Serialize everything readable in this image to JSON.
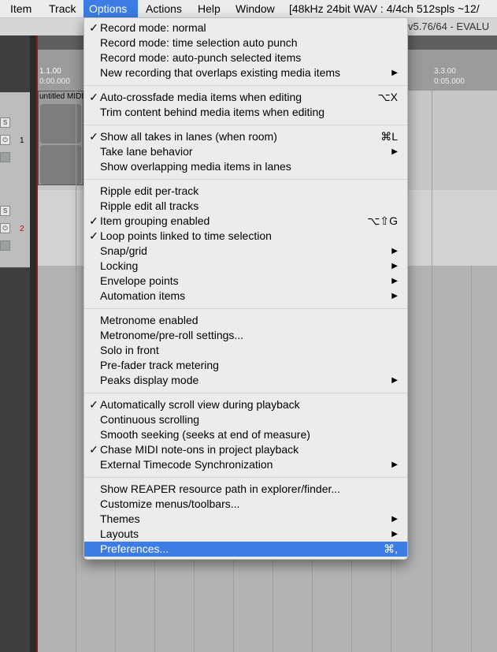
{
  "menubar": {
    "items": [
      "Item",
      "Track",
      "Options",
      "Actions",
      "Help",
      "Window"
    ],
    "active": "Options",
    "status": "[48kHz 24bit WAV : 4/4ch 512spls ~12/"
  },
  "window": {
    "version_text": "v5.76/64 - EVALU"
  },
  "ruler": {
    "marker_left": "1.1.00",
    "time_left": "0:00.000",
    "marker_right": "3.3.00",
    "time_right": "0:05.000"
  },
  "tracks": [
    {
      "number": "1",
      "button": "S"
    },
    {
      "number": "2",
      "button": "S"
    }
  ],
  "media_item": {
    "label": "untitled MIDI"
  },
  "menu": {
    "items": [
      {
        "label": "Record mode: normal",
        "checked": true
      },
      {
        "label": "Record mode: time selection auto punch"
      },
      {
        "label": "Record mode: auto-punch selected items"
      },
      {
        "label": "New recording that overlaps existing media items",
        "submenu": true
      },
      {
        "label": "Auto-crossfade media items when editing",
        "checked": true,
        "shortcut": "⌥X"
      },
      {
        "label": "Trim content behind media items when editing"
      },
      {
        "label": "Show all takes in lanes (when room)",
        "checked": true,
        "shortcut": "⌘L"
      },
      {
        "label": "Take lane behavior",
        "submenu": true
      },
      {
        "label": "Show overlapping media items in lanes"
      },
      {
        "label": "Ripple edit per-track"
      },
      {
        "label": "Ripple edit all tracks"
      },
      {
        "label": "Item grouping enabled",
        "checked": true,
        "shortcut": "⌥⇧G"
      },
      {
        "label": "Loop points linked to time selection",
        "checked": true
      },
      {
        "label": "Snap/grid",
        "submenu": true
      },
      {
        "label": "Locking",
        "submenu": true
      },
      {
        "label": "Envelope points",
        "submenu": true
      },
      {
        "label": "Automation items",
        "submenu": true
      },
      {
        "label": "Metronome enabled"
      },
      {
        "label": "Metronome/pre-roll settings..."
      },
      {
        "label": "Solo in front"
      },
      {
        "label": "Pre-fader track metering"
      },
      {
        "label": "Peaks display mode",
        "submenu": true
      },
      {
        "label": "Automatically scroll view during playback",
        "checked": true
      },
      {
        "label": "Continuous scrolling"
      },
      {
        "label": "Smooth seeking (seeks at end of measure)"
      },
      {
        "label": "Chase MIDI note-ons in project playback",
        "checked": true
      },
      {
        "label": "External Timecode Synchronization",
        "submenu": true
      },
      {
        "label": "Show REAPER resource path in explorer/finder..."
      },
      {
        "label": "Customize menus/toolbars..."
      },
      {
        "label": "Themes",
        "submenu": true
      },
      {
        "label": "Layouts",
        "submenu": true
      },
      {
        "label": "Preferences...",
        "shortcut": "⌘,",
        "highlighted": true
      }
    ]
  },
  "colors": {
    "highlight": "#3b7de4",
    "menu_bg": "#ececec"
  }
}
